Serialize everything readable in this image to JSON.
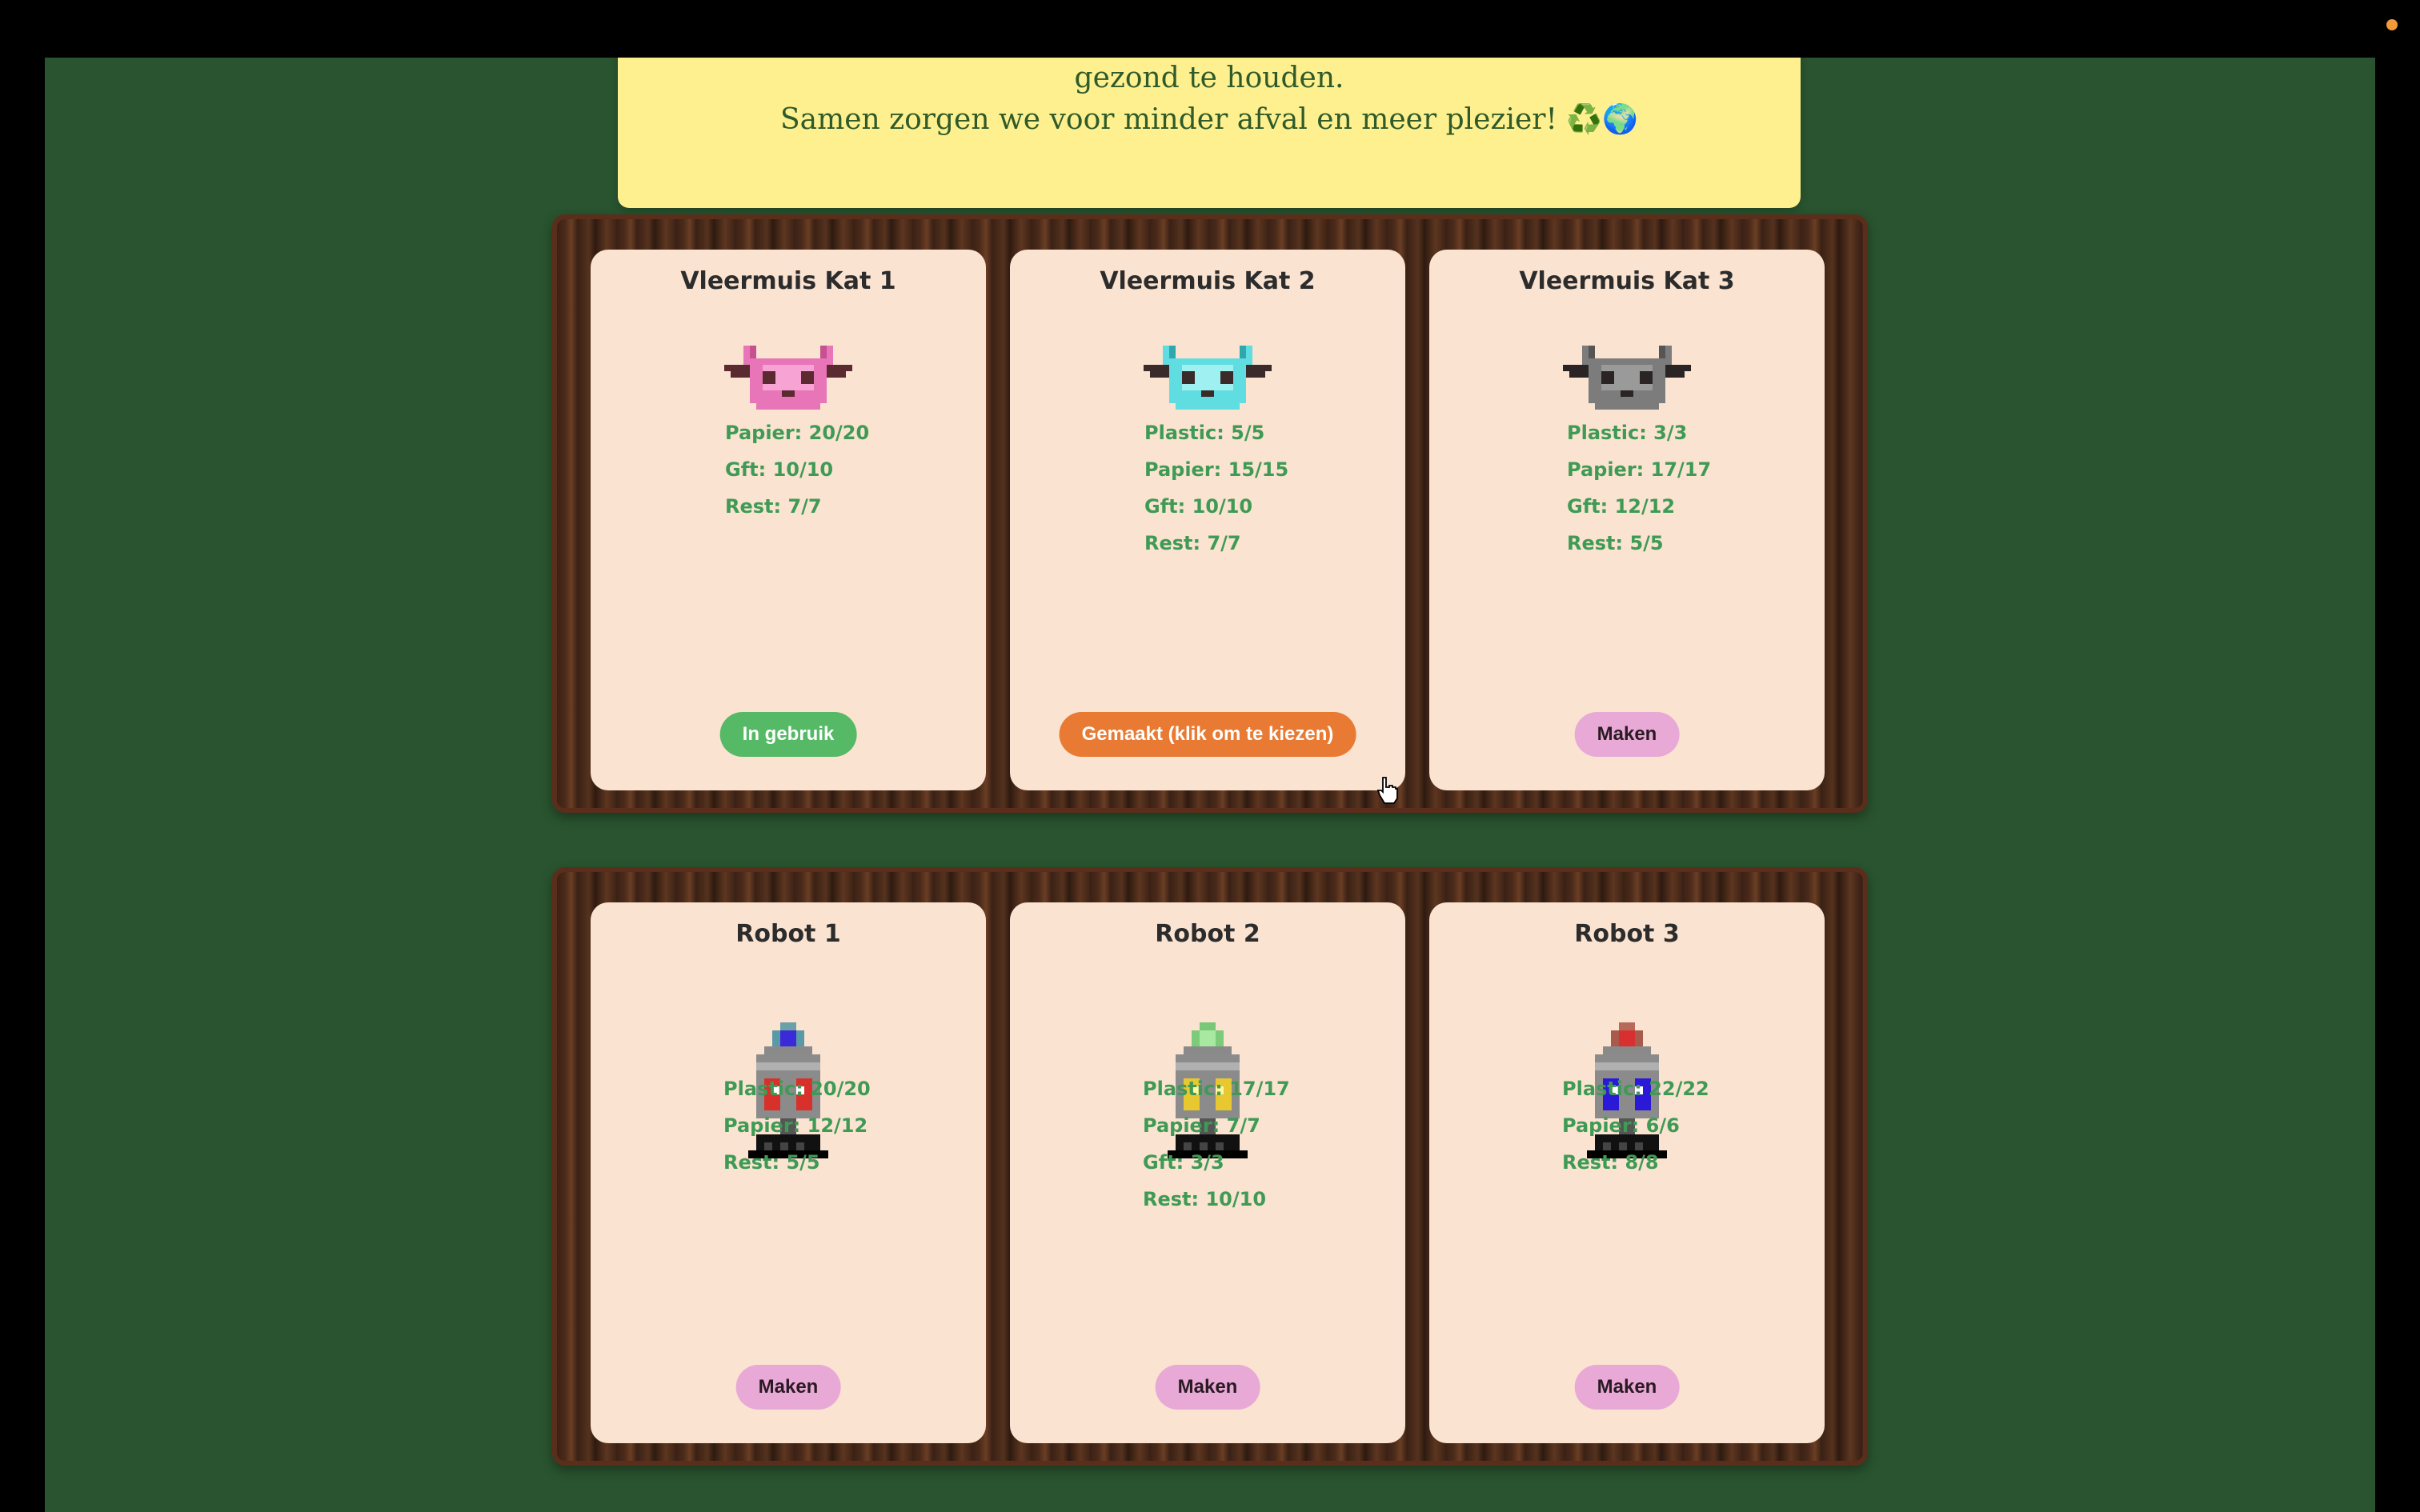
{
  "banner": {
    "line1": "gezond te houden.",
    "line2": "Samen zorgen we voor minder afval en meer plezier! ♻️🌍"
  },
  "shelves": [
    {
      "cards": [
        {
          "title": "Vleermuis Kat 1",
          "sprite": "pink-bat-cat-icon",
          "stats": [
            "Papier: 20/20",
            "Gft: 10/10",
            "Rest: 7/7"
          ],
          "button": "In gebruik"
        },
        {
          "title": "Vleermuis Kat 2",
          "sprite": "cyan-bat-cat-icon",
          "stats": [
            "Plastic: 5/5",
            "Papier: 15/15",
            "Gft: 10/10",
            "Rest: 7/7"
          ],
          "button": "Gemaakt (klik om te kiezen)"
        },
        {
          "title": "Vleermuis Kat 3",
          "sprite": "gray-bat-cat-icon",
          "stats": [
            "Plastic: 3/3",
            "Papier: 17/17",
            "Gft: 12/12",
            "Rest: 5/5"
          ],
          "button": "Maken"
        }
      ]
    },
    {
      "cards": [
        {
          "title": "Robot 1",
          "sprite": "robot-red-icon",
          "stats": [
            "Plastic: 20/20",
            "Papier: 12/12",
            "Rest: 5/5"
          ],
          "button": "Maken"
        },
        {
          "title": "Robot 2",
          "sprite": "robot-yellow-icon",
          "stats": [
            "Plastic: 17/17",
            "Papier: 7/7",
            "Gft: 3/3",
            "Rest: 10/10"
          ],
          "button": "Maken"
        },
        {
          "title": "Robot 3",
          "sprite": "robot-blue-icon",
          "stats": [
            "Plastic: 22/22",
            "Papier: 6/6",
            "Rest: 8/8"
          ],
          "button": "Maken"
        }
      ]
    }
  ],
  "colors": {
    "background": "#29542f",
    "card": "#fae3d1",
    "stat_text": "#3f9a55",
    "in_use": "#55b966",
    "made": "#e87a33",
    "make": "#e8a9d6"
  }
}
